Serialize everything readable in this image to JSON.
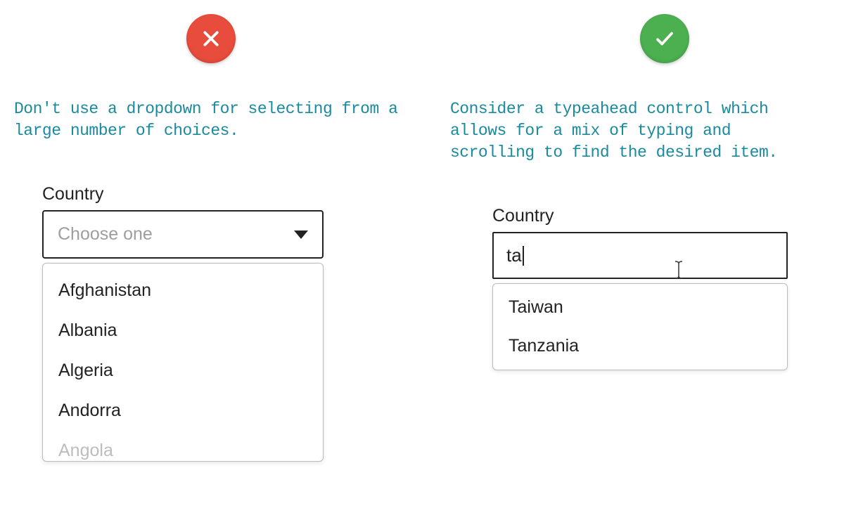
{
  "dont": {
    "caption": "Don't use a dropdown for selecting from a large number of choices.",
    "label": "Country",
    "placeholder": "Choose one",
    "options": [
      "Afghanistan",
      "Albania",
      "Algeria",
      "Andorra",
      "Angola"
    ]
  },
  "do": {
    "caption": "Consider a typeahead control which allows for a mix of typing and scrolling to find the desired item.",
    "label": "Country",
    "input_value": "ta",
    "suggestions": [
      "Taiwan",
      "Tanzania"
    ]
  },
  "colors": {
    "dont_badge": "#e74c3c",
    "do_badge": "#4caf50",
    "caption_text": "#1a8a9e"
  }
}
